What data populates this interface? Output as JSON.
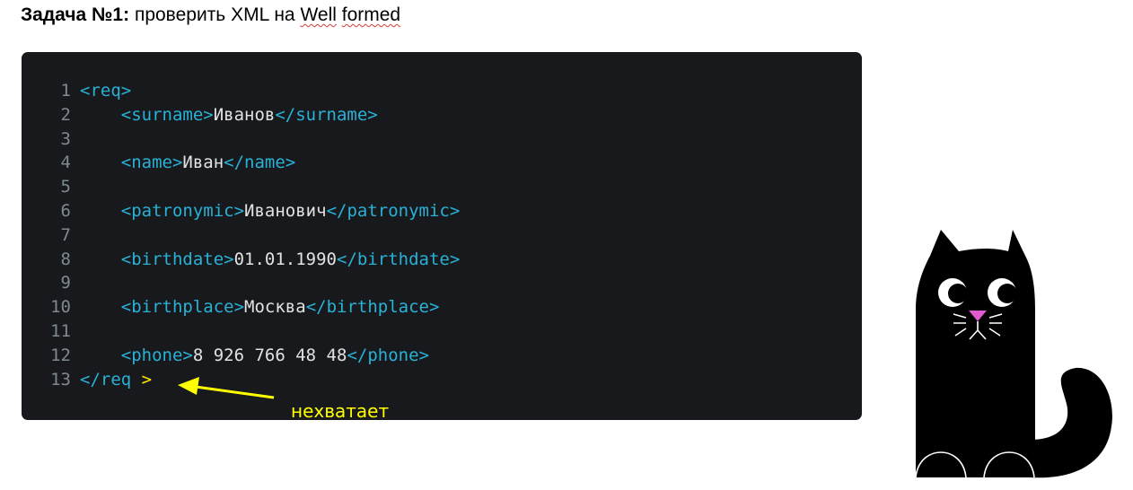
{
  "heading": {
    "bold": "Задача №1:",
    "text": "проверить XML на",
    "spell_word_1": "Well",
    "spell_word_2": "formed"
  },
  "code": {
    "lines": [
      {
        "num": "1",
        "indent": "",
        "open": "<req>",
        "value": "",
        "close": ""
      },
      {
        "num": "2",
        "indent": "    ",
        "open": "<surname>",
        "value": "Иванов",
        "close": "</surname>"
      },
      {
        "num": "3",
        "indent": "",
        "open": "",
        "value": "",
        "close": ""
      },
      {
        "num": "4",
        "indent": "    ",
        "open": "<name>",
        "value": "Иван",
        "close": "</name>"
      },
      {
        "num": "5",
        "indent": "",
        "open": "",
        "value": "",
        "close": ""
      },
      {
        "num": "6",
        "indent": "    ",
        "open": "<patronymic>",
        "value": "Иванович",
        "close": "</patronymic>"
      },
      {
        "num": "7",
        "indent": "",
        "open": "",
        "value": "",
        "close": ""
      },
      {
        "num": "8",
        "indent": "    ",
        "open": "<birthdate>",
        "value": "01.01.1990",
        "close": "</birthdate>"
      },
      {
        "num": "9",
        "indent": "",
        "open": "",
        "value": "",
        "close": ""
      },
      {
        "num": "10",
        "indent": "    ",
        "open": "<birthplace>",
        "value": "Москва",
        "close": "</birthplace>"
      },
      {
        "num": "11",
        "indent": "",
        "open": "",
        "value": "",
        "close": ""
      },
      {
        "num": "12",
        "indent": "    ",
        "open": "<phone>",
        "value": "8 926 766 48 48",
        "close": "</phone>"
      },
      {
        "num": "13",
        "indent": "",
        "open": "</req",
        "value": "",
        "close": ""
      }
    ],
    "missing_bracket": " >"
  },
  "annotation": {
    "text": "нехватает",
    "color": "#ffff00"
  },
  "colors": {
    "code_bg": "#17191c",
    "tag": "#2ab1d6",
    "text": "#e2e2e2",
    "line_number": "#7f8a8f"
  }
}
